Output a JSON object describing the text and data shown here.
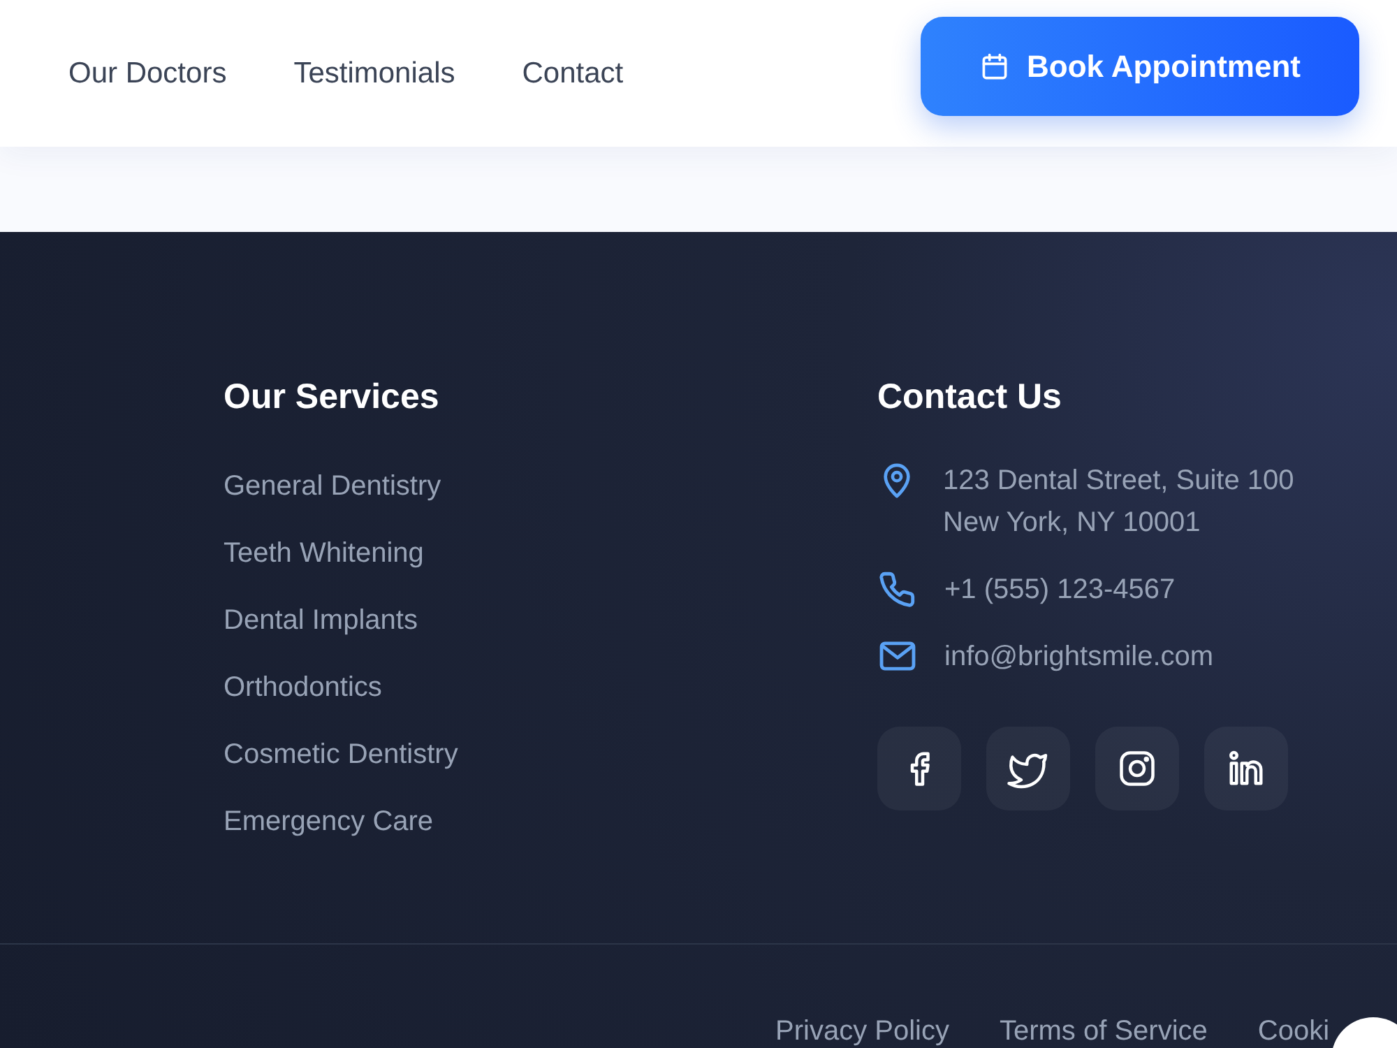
{
  "nav": {
    "links": [
      {
        "label": "Our Doctors"
      },
      {
        "label": "Testimonials"
      },
      {
        "label": "Contact"
      }
    ],
    "cta": {
      "label": "Book Appointment"
    }
  },
  "footer": {
    "services": {
      "title": "Our Services",
      "items": [
        "General Dentistry",
        "Teeth Whitening",
        "Dental Implants",
        "Orthodontics",
        "Cosmetic Dentistry",
        "Emergency Care"
      ]
    },
    "contact": {
      "title": "Contact Us",
      "items": [
        {
          "kind": "address",
          "lines": [
            "123 Dental Street, Suite 100",
            "New York, NY 10001"
          ]
        },
        {
          "kind": "phone",
          "lines": [
            "+1 (555) 123-4567"
          ]
        },
        {
          "kind": "email",
          "lines": [
            "info@brightsmile.com"
          ]
        }
      ]
    },
    "social": [
      {
        "kind": "facebook"
      },
      {
        "kind": "twitter"
      },
      {
        "kind": "instagram"
      },
      {
        "kind": "linkedin"
      }
    ],
    "legal_links": [
      "Privacy Policy",
      "Terms of Service",
      "Cooki"
    ]
  }
}
